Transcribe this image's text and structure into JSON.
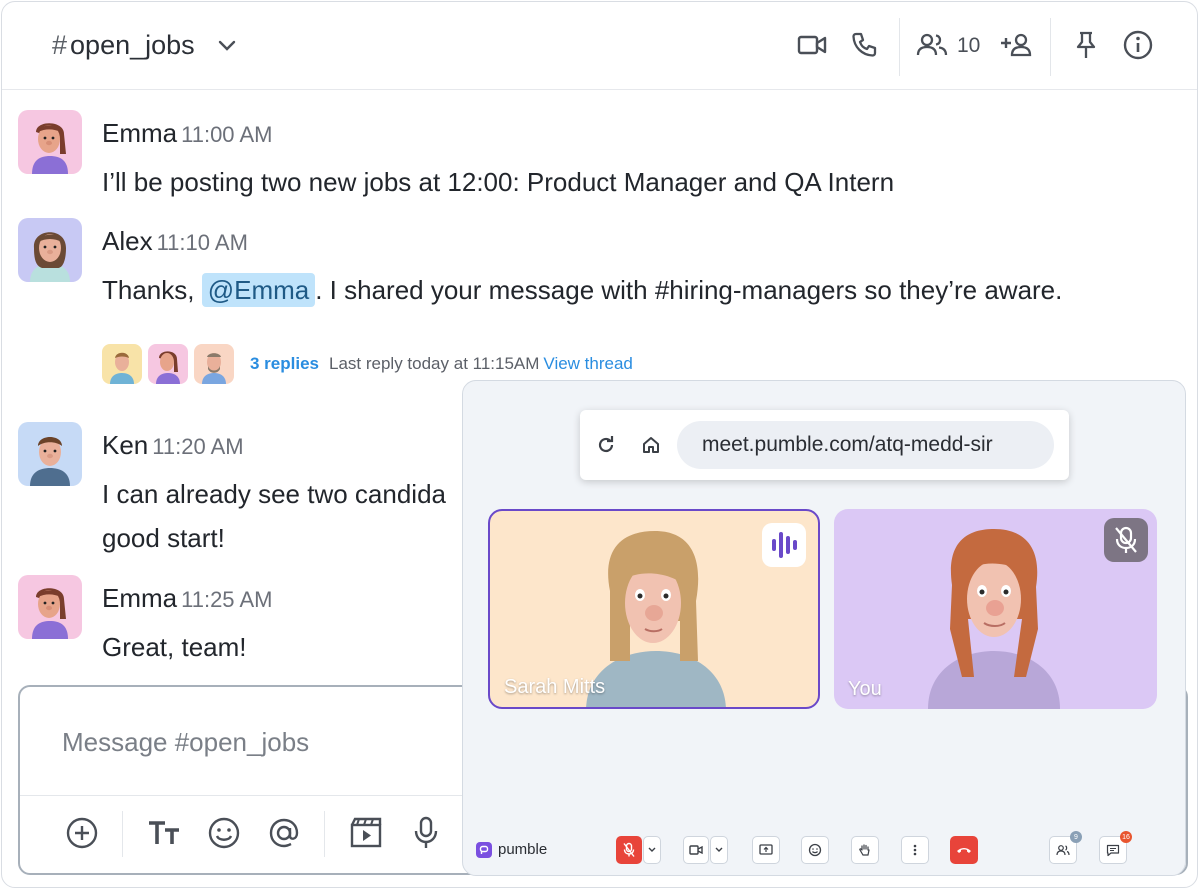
{
  "channel": {
    "hash": "#",
    "name": "open_jobs",
    "member_count": "10"
  },
  "messages": [
    {
      "author": "Emma",
      "time": "11:00 AM",
      "text": "I’ll be posting two new jobs at 12:00: Product Manager and QA Intern"
    },
    {
      "author": "Alex",
      "time": "11:10 AM",
      "text_before": "Thanks, ",
      "mention": "@Emma",
      "text_after": ". I shared your message with #hiring-managers so they’re aware."
    },
    {
      "author": "Ken",
      "time": "11:20 AM",
      "line1": "I can already see two candida",
      "line2": "good start!"
    },
    {
      "author": "Emma",
      "time": "11:25 AM",
      "text": "Great, team!"
    }
  ],
  "thread": {
    "replies": "3 replies",
    "last_reply": "Last reply today at 11:15AM",
    "view": "View thread"
  },
  "composer": {
    "placeholder": "Message #open_jobs"
  },
  "meeting": {
    "url": "meet.pumble.com/atq-medd-sir",
    "participants": [
      {
        "name": "Sarah Mitts",
        "speaking": true
      },
      {
        "name": "You",
        "muted": true
      }
    ],
    "brand": "pumble",
    "badges": {
      "participants": "9",
      "chat": "16"
    }
  },
  "colors": {
    "accent": "#2a8de0",
    "speaking_border": "#6a49c9",
    "hangup": "#e8443a",
    "mention_bg": "#bfe3fb"
  }
}
